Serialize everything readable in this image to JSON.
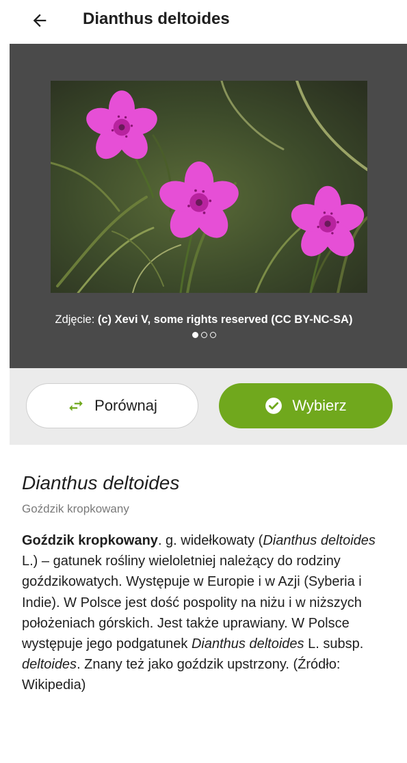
{
  "header": {
    "title": "Dianthus deltoides",
    "back_icon": "arrow-left-icon"
  },
  "gallery": {
    "photo_alt": "Dianthus deltoides",
    "caption_prefix": "Zdjęcie: ",
    "caption_credit": "(c) Xevi V, some rights reserved (CC BY-NC-SA)",
    "current_photo": 1,
    "photo_count": 3
  },
  "actions": {
    "compare_label": "Porównaj",
    "compare_icon": "swap-arrows-icon",
    "select_label": "Wybierz",
    "select_icon": "check-circle-icon"
  },
  "species": {
    "scientific_name": "Dianthus deltoides",
    "common_name": "Goździk kropkowany"
  },
  "description": {
    "bold_name": "Goździk kropkowany",
    "t1": ". g. widełkowaty (",
    "i1": "Dianthus deltoides",
    "t2": " L.) – gatunek rośliny wieloletniej należący do rodziny goździkowatych. Występuje w Europie i w Azji (Syberia i Indie). W Polsce jest dość pospolity na niżu i w niższych położeniach górskich. Jest także uprawiany. W Polsce występuje jego podgatunek ",
    "i2": "Dianthus deltoides",
    "t3": " L. subsp. ",
    "i3": "deltoides",
    "t4": ". Znany też jako goździk upstrzony. (Źródło: Wikipedia)"
  },
  "colors": {
    "accent_green": "#70a81d",
    "gallery_bg": "#4a4a4a",
    "actions_bg": "#ebebeb",
    "flower_pink": "#e64fd6"
  }
}
